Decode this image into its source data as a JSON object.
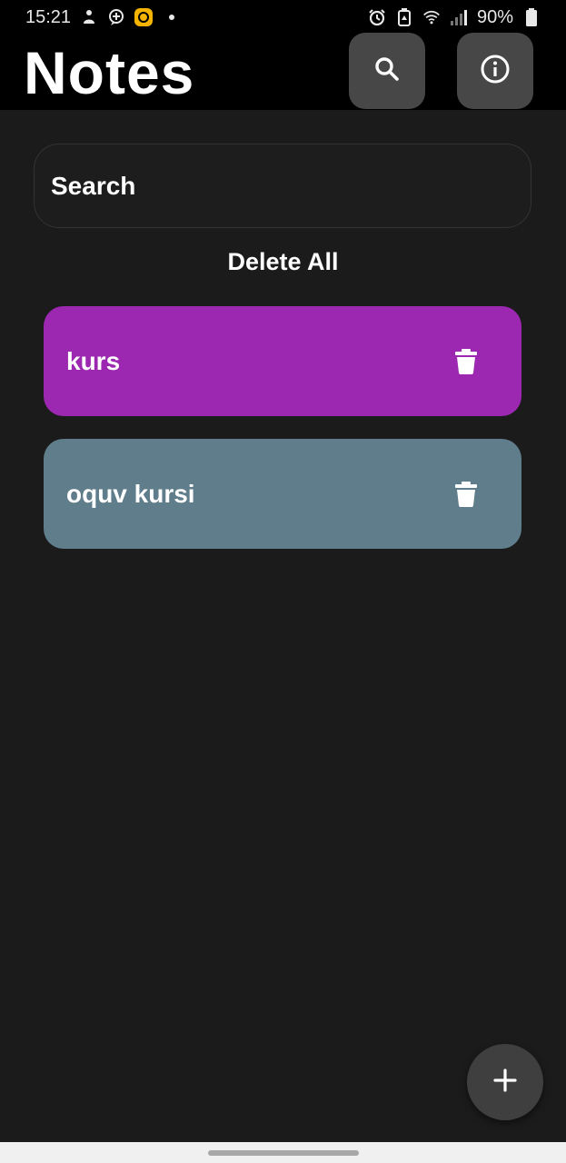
{
  "status_bar": {
    "time": "15:21",
    "battery": "90%",
    "icons": [
      "person-icon",
      "chat-plus-icon",
      "app-badge-icon",
      "dot-icon",
      "alarm-icon",
      "battery-saver-icon",
      "wifi-icon",
      "signal-icon",
      "battery-icon"
    ]
  },
  "app_bar": {
    "title": "Notes",
    "search_icon": "search-icon",
    "info_icon": "info-icon"
  },
  "search": {
    "placeholder": "Search"
  },
  "actions": {
    "delete_all": "Delete All"
  },
  "notes": [
    {
      "title": "kurs",
      "color": "#9c27b0"
    },
    {
      "title": "oquv kursi",
      "color": "#607d8b"
    }
  ],
  "fab": {
    "icon": "plus-icon"
  },
  "colors": {
    "background": "#1b1b1b",
    "app_bar": "#000000",
    "icon_button": "#474747",
    "fab": "#3f3f3f"
  }
}
